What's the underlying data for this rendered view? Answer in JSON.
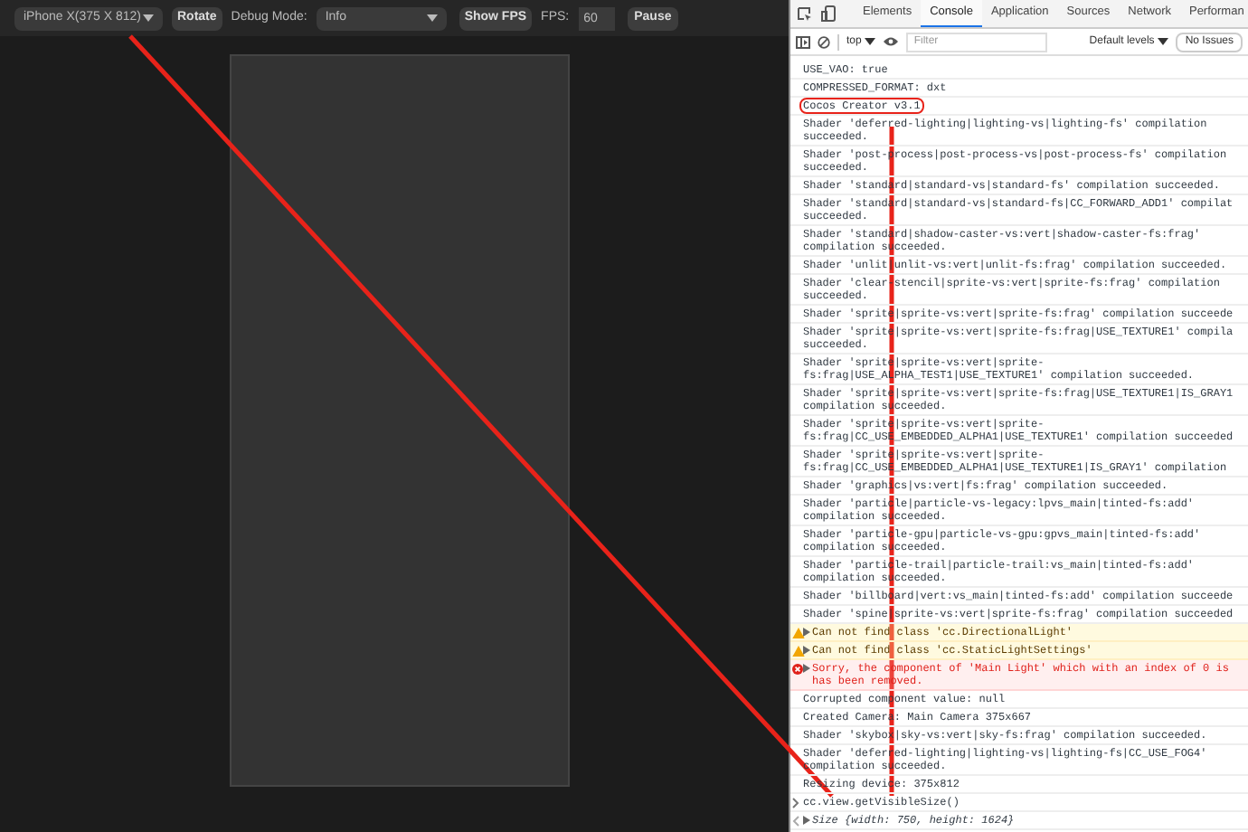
{
  "simulator": {
    "toolbar": {
      "device": "iPhone X(375 X 812)",
      "rotate": "Rotate",
      "debug_label": "Debug Mode:",
      "debug_mode": "Info",
      "show_fps": "Show FPS",
      "fps_label": "FPS:",
      "fps_value": "60",
      "pause": "Pause"
    }
  },
  "devtools": {
    "tabs": [
      {
        "label": "Elements",
        "selected": false
      },
      {
        "label": "Console",
        "selected": true
      },
      {
        "label": "Application",
        "selected": false
      },
      {
        "label": "Sources",
        "selected": false
      },
      {
        "label": "Network",
        "selected": false
      },
      {
        "label": "Performan",
        "selected": false
      }
    ],
    "toolbar": {
      "context": "top",
      "filter": {
        "placeholder": "Filter"
      },
      "levels": "Default levels",
      "issues": "No Issues"
    },
    "console": [
      {
        "kind": "log",
        "lines": [
          "USE_VAO: true"
        ]
      },
      {
        "kind": "log",
        "lines": [
          "COMPRESSED_FORMAT: dxt"
        ]
      },
      {
        "kind": "log",
        "lines": [
          "Cocos Creator v3.1"
        ],
        "highlighted": true
      },
      {
        "kind": "log",
        "lines": [
          "Shader 'deferred-lighting|lighting-vs|lighting-fs' compilation",
          "succeeded."
        ]
      },
      {
        "kind": "log",
        "lines": [
          "Shader 'post-process|post-process-vs|post-process-fs' compilation",
          "succeeded."
        ]
      },
      {
        "kind": "log",
        "lines": [
          "Shader 'standard|standard-vs|standard-fs' compilation succeeded."
        ]
      },
      {
        "kind": "log",
        "lines": [
          "Shader 'standard|standard-vs|standard-fs|CC_FORWARD_ADD1' compilat",
          "succeeded."
        ]
      },
      {
        "kind": "log",
        "lines": [
          "Shader 'standard|shadow-caster-vs:vert|shadow-caster-fs:frag'",
          "compilation succeeded."
        ]
      },
      {
        "kind": "log",
        "lines": [
          "Shader 'unlit|unlit-vs:vert|unlit-fs:frag' compilation succeeded."
        ]
      },
      {
        "kind": "log",
        "lines": [
          "Shader 'clear-stencil|sprite-vs:vert|sprite-fs:frag' compilation",
          "succeeded."
        ]
      },
      {
        "kind": "log",
        "lines": [
          "Shader 'sprite|sprite-vs:vert|sprite-fs:frag' compilation succeede"
        ]
      },
      {
        "kind": "log",
        "lines": [
          "Shader 'sprite|sprite-vs:vert|sprite-fs:frag|USE_TEXTURE1' compila",
          "succeeded."
        ]
      },
      {
        "kind": "log",
        "lines": [
          "Shader 'sprite|sprite-vs:vert|sprite-",
          "fs:frag|USE_ALPHA_TEST1|USE_TEXTURE1' compilation succeeded."
        ]
      },
      {
        "kind": "log",
        "lines": [
          "Shader 'sprite|sprite-vs:vert|sprite-fs:frag|USE_TEXTURE1|IS_GRAY1",
          "compilation succeeded."
        ]
      },
      {
        "kind": "log",
        "lines": [
          "Shader 'sprite|sprite-vs:vert|sprite-",
          "fs:frag|CC_USE_EMBEDDED_ALPHA1|USE_TEXTURE1' compilation succeeded"
        ]
      },
      {
        "kind": "log",
        "lines": [
          "Shader 'sprite|sprite-vs:vert|sprite-",
          "fs:frag|CC_USE_EMBEDDED_ALPHA1|USE_TEXTURE1|IS_GRAY1' compilation"
        ]
      },
      {
        "kind": "log",
        "lines": [
          "Shader 'graphics|vs:vert|fs:frag' compilation succeeded."
        ]
      },
      {
        "kind": "log",
        "lines": [
          "Shader 'particle|particle-vs-legacy:lpvs_main|tinted-fs:add'",
          "compilation succeeded."
        ]
      },
      {
        "kind": "log",
        "lines": [
          "Shader 'particle-gpu|particle-vs-gpu:gpvs_main|tinted-fs:add'",
          "compilation succeeded."
        ]
      },
      {
        "kind": "log",
        "lines": [
          "Shader 'particle-trail|particle-trail:vs_main|tinted-fs:add'",
          "compilation succeeded."
        ]
      },
      {
        "kind": "log",
        "lines": [
          "Shader 'billboard|vert:vs_main|tinted-fs:add' compilation succeede"
        ]
      },
      {
        "kind": "log",
        "lines": [
          "Shader 'spine|sprite-vs:vert|sprite-fs:frag' compilation succeeded"
        ]
      },
      {
        "kind": "warn",
        "lines": [
          "Can not find class 'cc.DirectionalLight'"
        ]
      },
      {
        "kind": "warn",
        "lines": [
          "Can not find class 'cc.StaticLightSettings'"
        ]
      },
      {
        "kind": "error",
        "lines": [
          "Sorry, the component of 'Main Light' which with an index of 0 is",
          "has been removed."
        ]
      },
      {
        "kind": "log",
        "lines": [
          "Corrupted component value: null"
        ]
      },
      {
        "kind": "log",
        "lines": [
          "Created Camera: Main Camera 375x667"
        ]
      },
      {
        "kind": "log",
        "lines": [
          "Shader 'skybox|sky-vs:vert|sky-fs:frag' compilation succeeded."
        ]
      },
      {
        "kind": "log",
        "lines": [
          "Shader 'deferred-lighting|lighting-vs|lighting-fs|CC_USE_FOG4'",
          "compilation succeeded."
        ]
      },
      {
        "kind": "log",
        "lines": [
          "Resizing device: 375x812"
        ]
      },
      {
        "kind": "input",
        "lines": [
          "cc.view.getVisibleSize()"
        ]
      },
      {
        "kind": "result",
        "lines": [
          "Size {width: *750*, height: *1624*}"
        ]
      }
    ]
  }
}
